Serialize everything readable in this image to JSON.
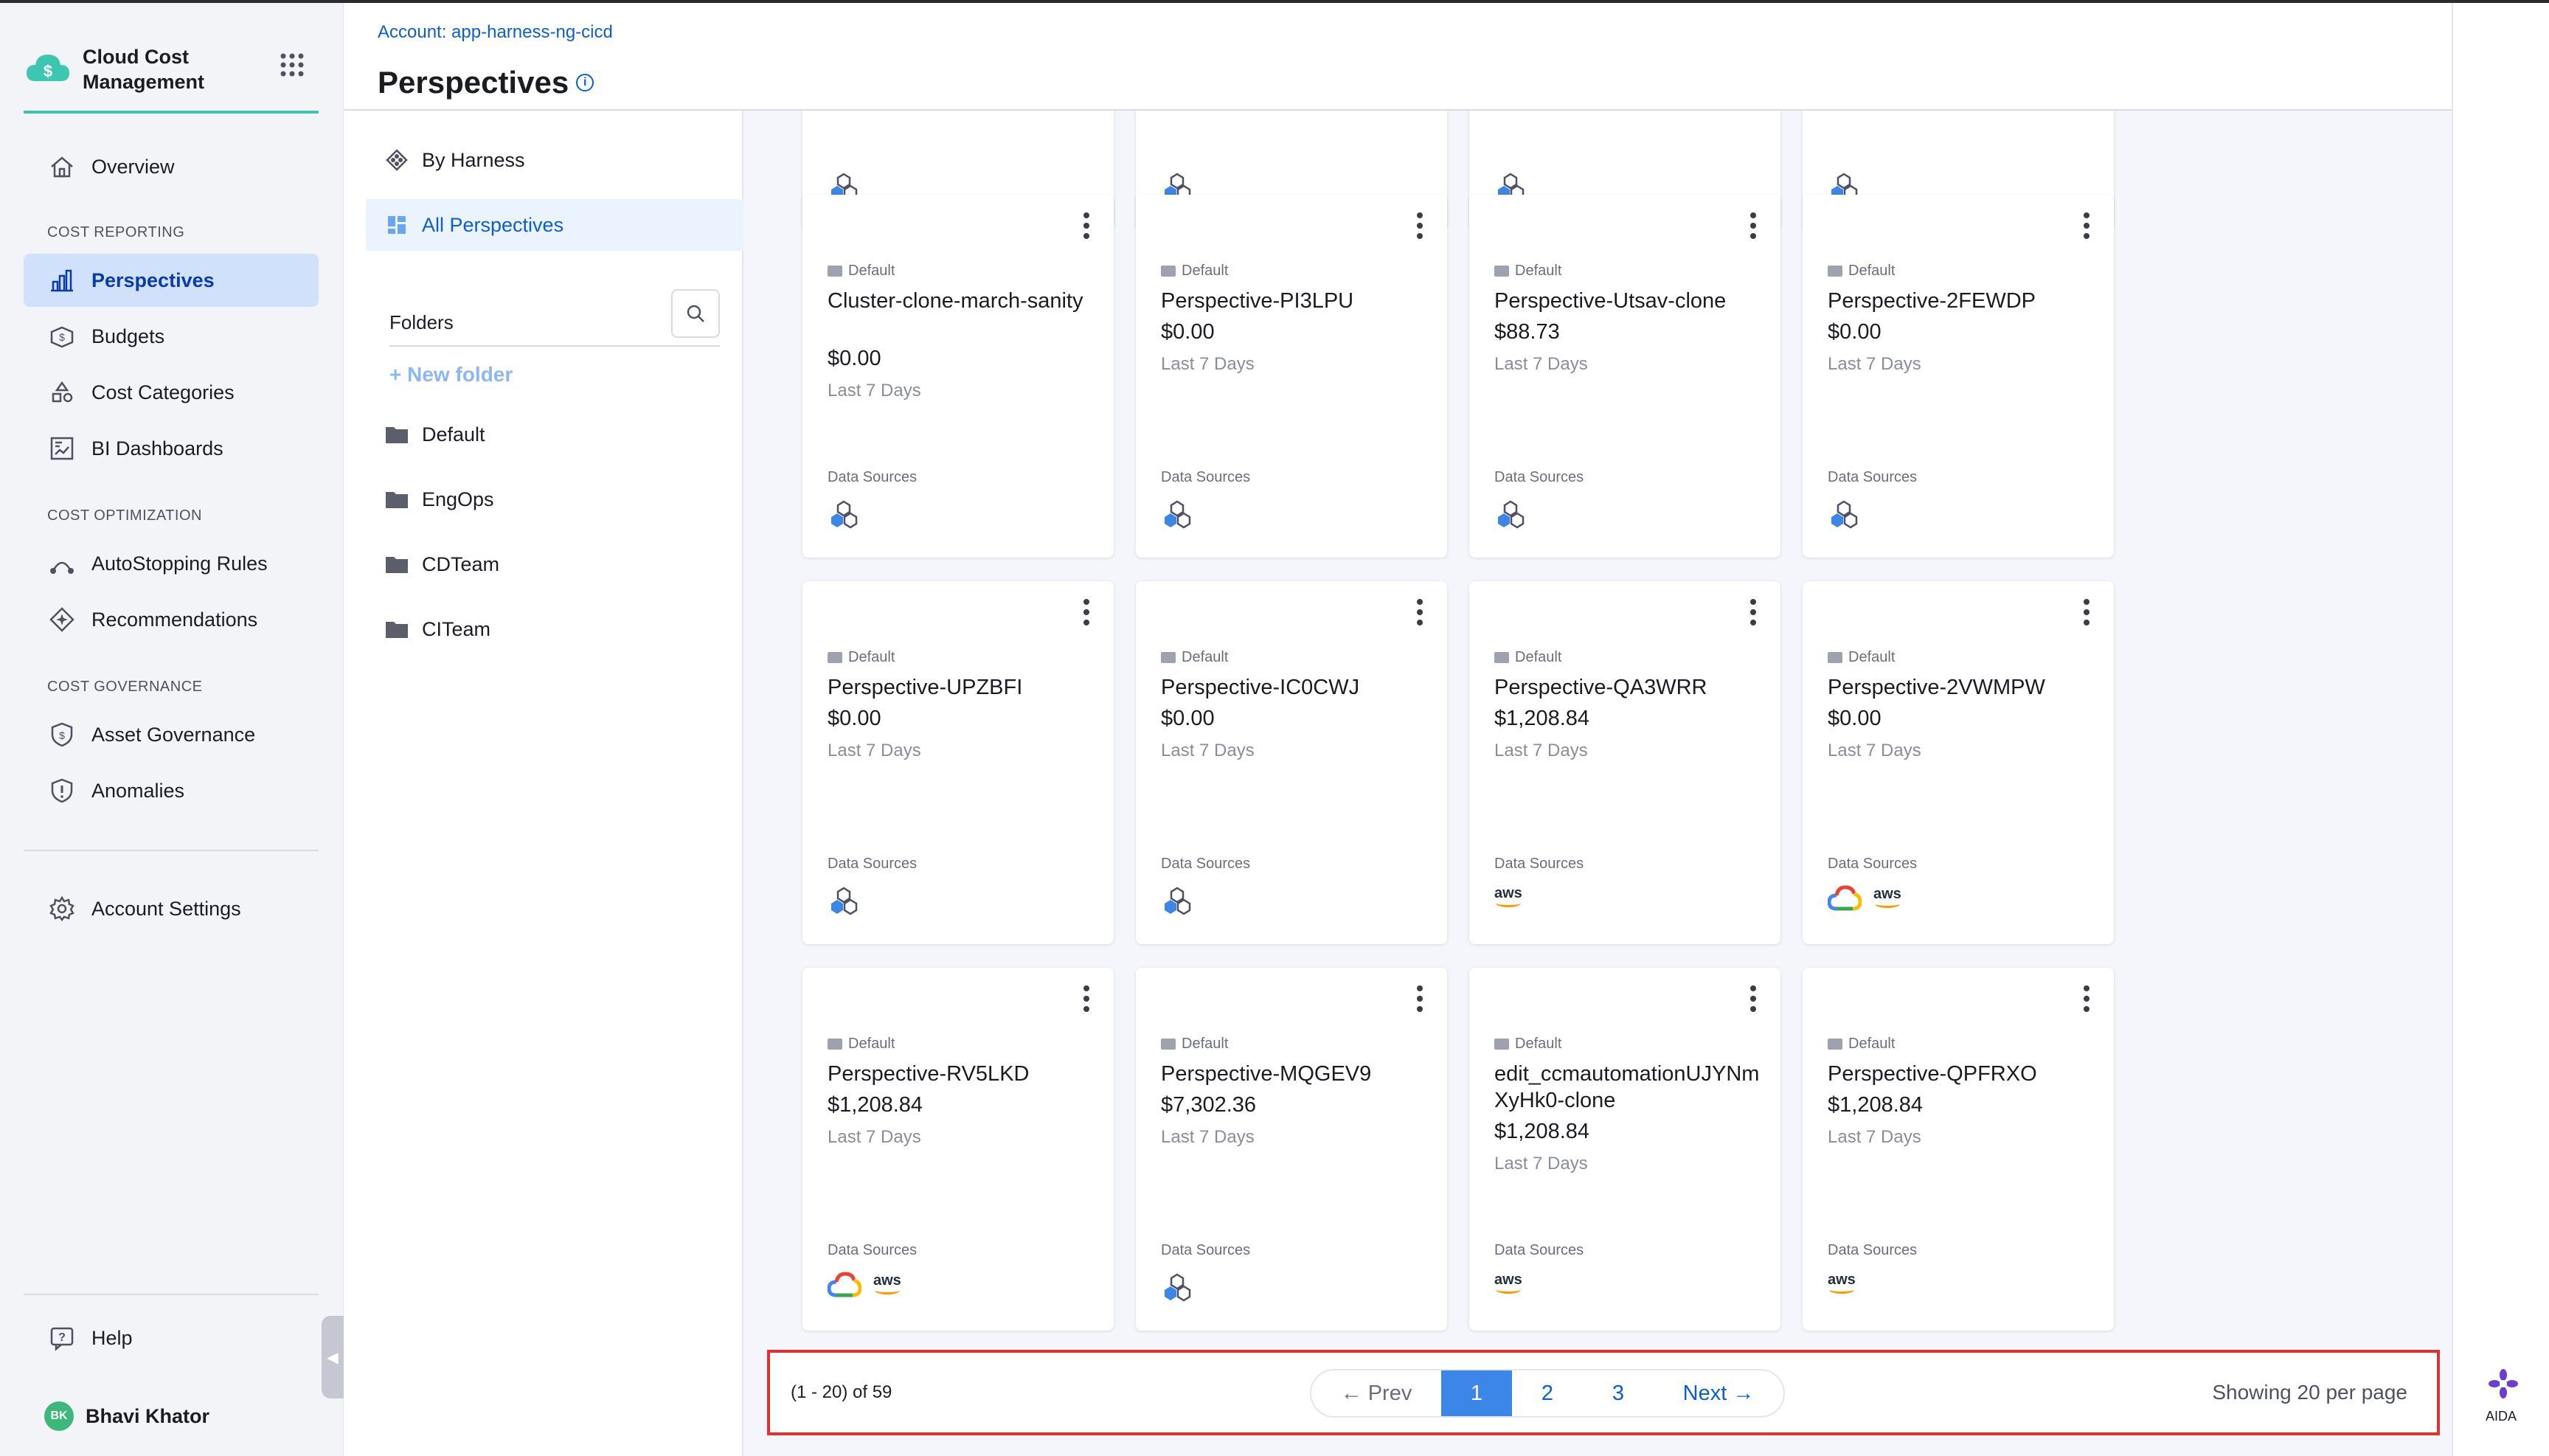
{
  "app": {
    "name": "Cloud Cost Management",
    "brand_color": "#3dc7b0"
  },
  "nav": {
    "overview": "Overview",
    "sections": [
      {
        "title": "COST REPORTING",
        "items": [
          "Perspectives",
          "Budgets",
          "Cost Categories",
          "BI Dashboards"
        ]
      },
      {
        "title": "COST OPTIMIZATION",
        "items": [
          "AutoStopping Rules",
          "Recommendations"
        ]
      },
      {
        "title": "COST GOVERNANCE",
        "items": [
          "Asset Governance",
          "Anomalies"
        ]
      }
    ],
    "active": "Perspectives",
    "account_settings": "Account Settings",
    "help": "Help",
    "user": {
      "initials": "BK",
      "name": "Bhavi Khator"
    }
  },
  "header": {
    "account": "Account: app-harness-ng-cicd",
    "title": "Perspectives"
  },
  "folders": {
    "by_harness": "By Harness",
    "all_perspectives": "All Perspectives",
    "title": "Folders",
    "new_folder": "New folder",
    "list": [
      "Default",
      "EngOps",
      "CDTeam",
      "CITeam"
    ]
  },
  "cards": [
    {
      "folder": "Default",
      "name": "Cluster-clone-march-sanity",
      "cost": "$0.00",
      "period": "Last 7 Days",
      "ds_label": "Data Sources",
      "sources": [
        "cluster"
      ]
    },
    {
      "folder": "Default",
      "name": "Perspective-PI3LPU",
      "cost": "$0.00",
      "period": "Last 7 Days",
      "ds_label": "Data Sources",
      "sources": [
        "cluster"
      ]
    },
    {
      "folder": "Default",
      "name": "Perspective-Utsav-clone",
      "cost": "$88.73",
      "period": "Last 7 Days",
      "ds_label": "Data Sources",
      "sources": [
        "cluster"
      ]
    },
    {
      "folder": "Default",
      "name": "Perspective-2FEWDP",
      "cost": "$0.00",
      "period": "Last 7 Days",
      "ds_label": "Data Sources",
      "sources": [
        "cluster"
      ]
    },
    {
      "folder": "Default",
      "name": "Perspective-UPZBFI",
      "cost": "$0.00",
      "period": "Last 7 Days",
      "ds_label": "Data Sources",
      "sources": [
        "cluster"
      ]
    },
    {
      "folder": "Default",
      "name": "Perspective-IC0CWJ",
      "cost": "$0.00",
      "period": "Last 7 Days",
      "ds_label": "Data Sources",
      "sources": [
        "cluster"
      ]
    },
    {
      "folder": "Default",
      "name": "Perspective-QA3WRR",
      "cost": "$1,208.84",
      "period": "Last 7 Days",
      "ds_label": "Data Sources",
      "sources": [
        "aws"
      ]
    },
    {
      "folder": "Default",
      "name": "Perspective-2VWMPW",
      "cost": "$0.00",
      "period": "Last 7 Days",
      "ds_label": "Data Sources",
      "sources": [
        "gcp",
        "aws"
      ]
    },
    {
      "folder": "Default",
      "name": "Perspective-RV5LKD",
      "cost": "$1,208.84",
      "period": "Last 7 Days",
      "ds_label": "Data Sources",
      "sources": [
        "gcp",
        "aws"
      ]
    },
    {
      "folder": "Default",
      "name": "Perspective-MQGEV9",
      "cost": "$7,302.36",
      "period": "Last 7 Days",
      "ds_label": "Data Sources",
      "sources": [
        "cluster"
      ]
    },
    {
      "folder": "Default",
      "name": "edit_ccmautomationUJYNmXyHk0-clone",
      "cost": "$1,208.84",
      "period": "Last 7 Days",
      "ds_label": "Data Sources",
      "sources": [
        "aws"
      ]
    },
    {
      "folder": "Default",
      "name": "Perspective-QPFRXO",
      "cost": "$1,208.84",
      "period": "Last 7 Days",
      "ds_label": "Data Sources",
      "sources": [
        "aws"
      ]
    }
  ],
  "pagination": {
    "count": "(1 - 20) of 59",
    "prev": "Prev",
    "pages": [
      "1",
      "2",
      "3"
    ],
    "current": "1",
    "next": "Next",
    "per_page": "Showing 20 per page"
  },
  "rail": {
    "aida": "AIDA"
  },
  "aws_label": "aws"
}
